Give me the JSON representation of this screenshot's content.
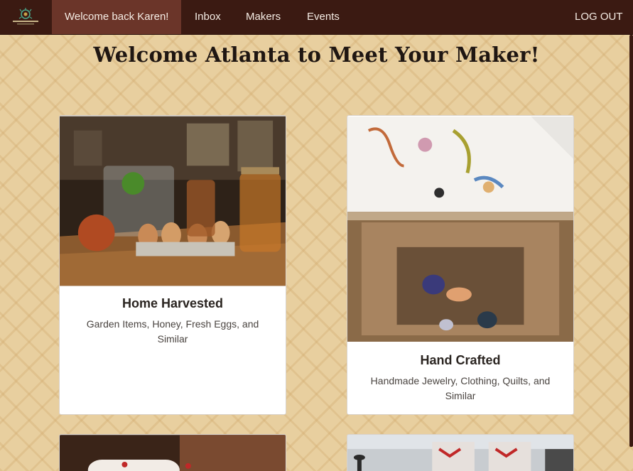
{
  "nav": {
    "active_label": "Welcome back Karen!",
    "items": [
      "Inbox",
      "Makers",
      "Events"
    ],
    "logout_label": "LOG OUT"
  },
  "page": {
    "title": "Welcome Atlanta to Meet Your Maker!"
  },
  "cards": [
    {
      "title": "Home Harvested",
      "description": "Garden Items, Honey, Fresh Eggs, and Similar"
    },
    {
      "title": "Hand Crafted",
      "description": "Handmade Jewelry, Clothing, Quilts, and Similar"
    }
  ],
  "colors": {
    "navbar": "#3b1a12",
    "active_nav": "#6b3529",
    "page_background": "#e8cf9f"
  },
  "icons": {
    "logo": "wreath-logo-icon"
  }
}
